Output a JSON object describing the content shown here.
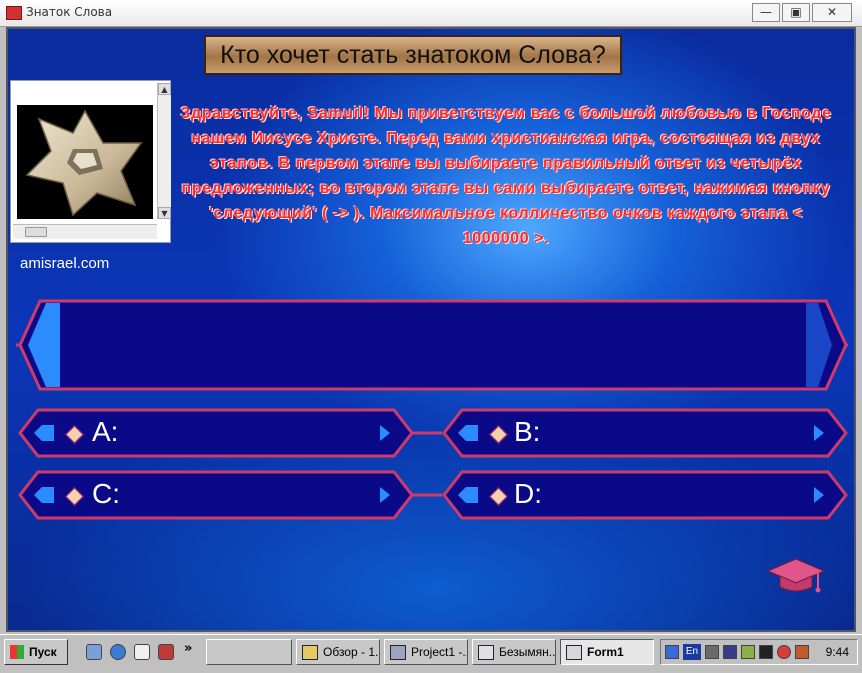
{
  "window": {
    "title": "Знаток Слова",
    "minimize_label": "—",
    "maximize_label": "▣",
    "close_label": "✕"
  },
  "game": {
    "title": "Кто хочет стать знатоком Слова?",
    "site": "amisrael.com",
    "welcome": "Здравствуйте, Samuil! Мы приветствуем вас с большой любовью в Господе нашем Иисусе Христе. Перед вами христианская игра, состоящая из двух этапов. В первом этапе вы выбираете правильный ответ из четырёх предложенных; во втором этапе вы сами выбираете ответ, нажимая кнопку 'следующий' ( -> ). Максимальное колличество очков каждого этапа < 1000000 >.",
    "question": "",
    "answers": [
      {
        "letter": "A:",
        "text": ""
      },
      {
        "letter": "B:",
        "text": ""
      },
      {
        "letter": "C:",
        "text": ""
      },
      {
        "letter": "D:",
        "text": ""
      }
    ]
  },
  "taskbar": {
    "start_label": "Пуск",
    "more_label": "»",
    "items": [
      {
        "label": ""
      },
      {
        "label": "Обзор - 1..."
      },
      {
        "label": "Project1 -..."
      },
      {
        "label": "Безымян..."
      },
      {
        "label": "Form1"
      }
    ],
    "tray": {
      "lang": "En",
      "time": "9:44"
    }
  },
  "colors": {
    "background_blue": "#0a36b8",
    "panel_fill": "#0a0a88",
    "panel_border": "#d03a6a",
    "welcome_text": "#ff2a2a",
    "arrow_blue": "#2c8cff"
  },
  "icons": {
    "cap": "graduation-cap-icon",
    "star": "star-of-david-icon"
  }
}
